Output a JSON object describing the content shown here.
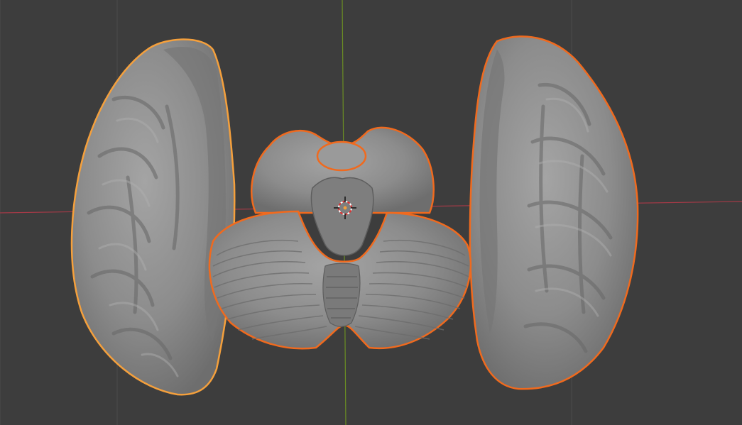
{
  "viewport": {
    "background_color": "#3d3d3d",
    "grid_color": "#4a4a4a",
    "x_axis_color": "#a33a47",
    "y_axis_color": "#6b8e23"
  },
  "objects": [
    {
      "name": "left-cerebral-hemisphere",
      "selection": "active",
      "outline_color": "#f5a03c"
    },
    {
      "name": "brainstem",
      "selection": "selected",
      "outline_color": "#f06a1e"
    },
    {
      "name": "cerebellum",
      "selection": "selected",
      "outline_color": "#f06a1e"
    },
    {
      "name": "right-cerebral-hemisphere",
      "selection": "selected",
      "outline_color": "#f06a1e"
    }
  ],
  "mesh_color": "#8e8e8e",
  "cursor_icon": "3d-cursor-icon"
}
